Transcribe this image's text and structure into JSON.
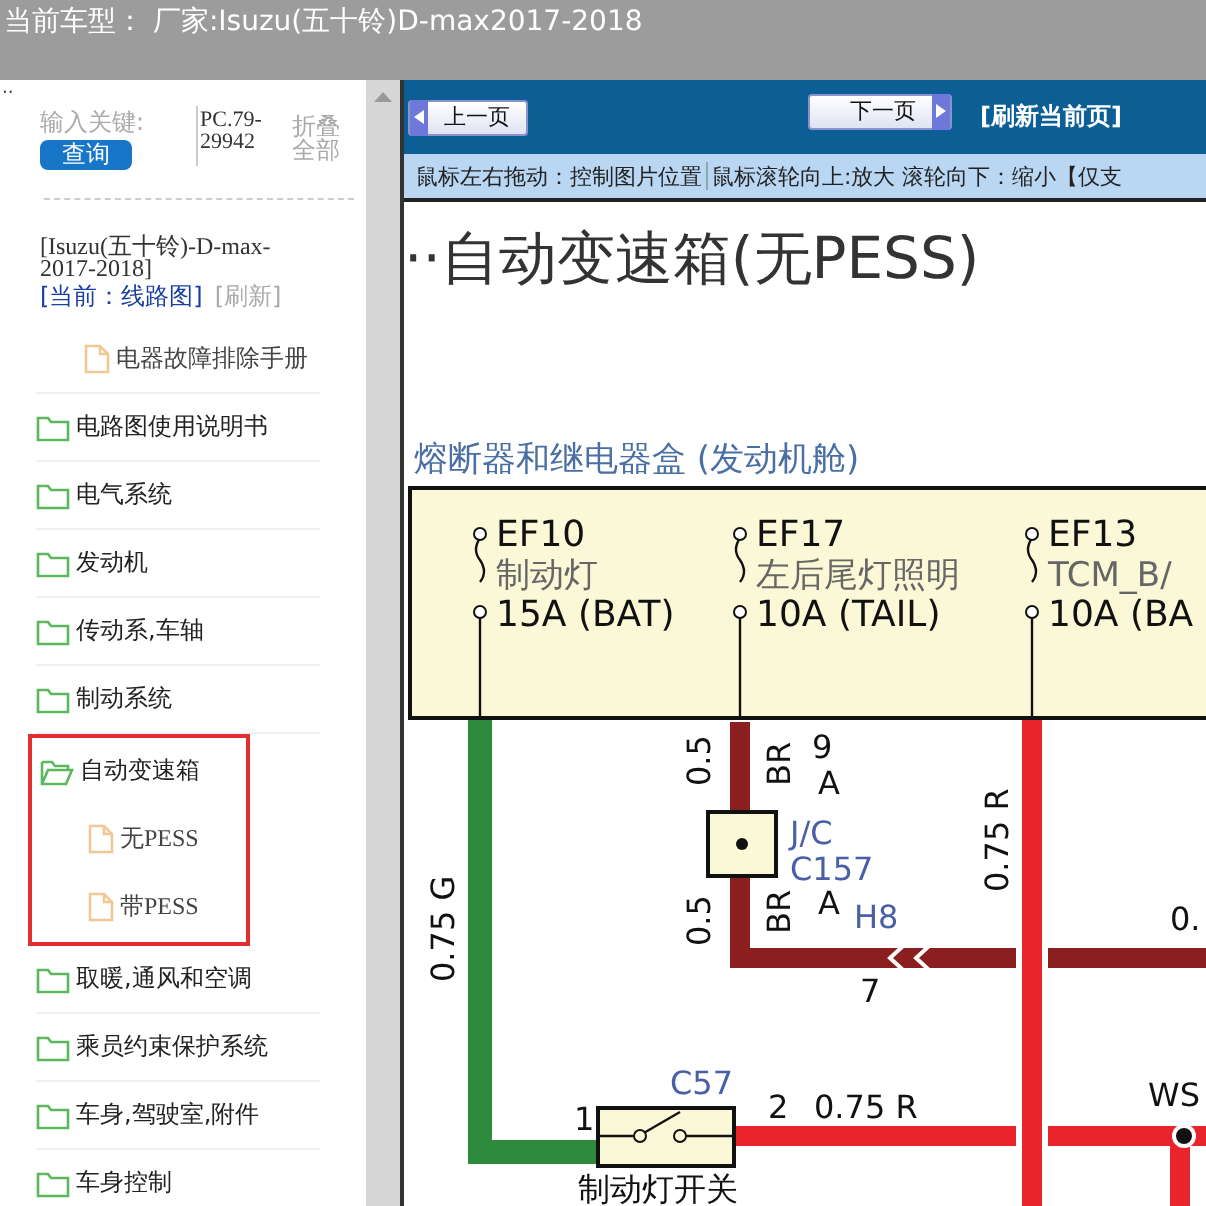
{
  "title": "当前车型： 厂家:Isuzu(五十铃)D-max2017-2018",
  "marker": "··",
  "search": {
    "label": "输入关键:",
    "button": "查询",
    "code": "PC.79-29942",
    "collapse": "折叠全部"
  },
  "vehicle": {
    "name": "[Isuzu(五十铃)-D-max-2017-2018]",
    "current": "[当前：线路图]",
    "refresh": "[刷新]"
  },
  "tree": [
    {
      "label": "电器故障排除手册",
      "kind": "file"
    },
    {
      "label": "电路图使用说明书",
      "kind": "folder",
      "expanded": false
    },
    {
      "label": "电气系统",
      "kind": "folder",
      "expanded": false
    },
    {
      "label": "发动机",
      "kind": "folder",
      "expanded": false
    },
    {
      "label": "传动系,车轴",
      "kind": "folder",
      "expanded": false
    },
    {
      "label": "制动系统",
      "kind": "folder",
      "expanded": false
    },
    {
      "label": "自动变速箱",
      "kind": "folder",
      "expanded": true,
      "highlighted": true,
      "children": [
        {
          "label": "无PESS",
          "kind": "file"
        },
        {
          "label": "带PESS",
          "kind": "file"
        }
      ]
    },
    {
      "label": "取暖,通风和空调",
      "kind": "folder",
      "expanded": false
    },
    {
      "label": "乘员约束保护系统",
      "kind": "folder",
      "expanded": false
    },
    {
      "label": "车身,驾驶室,附件",
      "kind": "folder",
      "expanded": false
    },
    {
      "label": "车身控制",
      "kind": "folder",
      "expanded": false
    }
  ],
  "toolbar": {
    "prev": "上一页",
    "next": "下一页",
    "refresh": "[刷新当前页]",
    "hints": [
      "鼠标左右拖动：控制图片位置",
      "鼠标滚轮向上:放大  滚轮向下：缩小【仅支"
    ]
  },
  "diagram": {
    "title": "··自动变速箱(无PESS)",
    "box_title": "熔断器和继电器盒 (发动机舱)",
    "fuses": [
      {
        "id": "EF10",
        "name": "制动灯",
        "rating": "15A (BAT)"
      },
      {
        "id": "EF17",
        "name": "左后尾灯照明",
        "rating": "10A (TAIL)"
      },
      {
        "id": "EF13",
        "name": "TCM_B/",
        "rating": "10A (BA"
      }
    ],
    "labels": [
      {
        "text": "0.5",
        "kind": "gauge"
      },
      {
        "text": "BR",
        "kind": "gauge"
      },
      {
        "text": "9",
        "kind": "pin"
      },
      {
        "text": "A",
        "kind": "pin"
      },
      {
        "text": "J/C",
        "kind": "connector"
      },
      {
        "text": "C157",
        "kind": "connector"
      },
      {
        "text": "0.5",
        "kind": "gauge"
      },
      {
        "text": "BR",
        "kind": "gauge"
      },
      {
        "text": "A",
        "kind": "pin"
      },
      {
        "text": "H8",
        "kind": "connector"
      },
      {
        "text": "7",
        "kind": "pin"
      },
      {
        "text": "0.75 R",
        "kind": "gauge"
      },
      {
        "text": "0.",
        "kind": "pin"
      },
      {
        "text": "0.75 G",
        "kind": "gauge"
      },
      {
        "text": "C57",
        "kind": "connector"
      },
      {
        "text": "1",
        "kind": "pin"
      },
      {
        "text": "2",
        "kind": "pin"
      },
      {
        "text": "0.75 R",
        "kind": "pin"
      },
      {
        "text": "WS",
        "kind": "pin"
      },
      {
        "text": "制动灯开关",
        "kind": "pin"
      }
    ]
  }
}
